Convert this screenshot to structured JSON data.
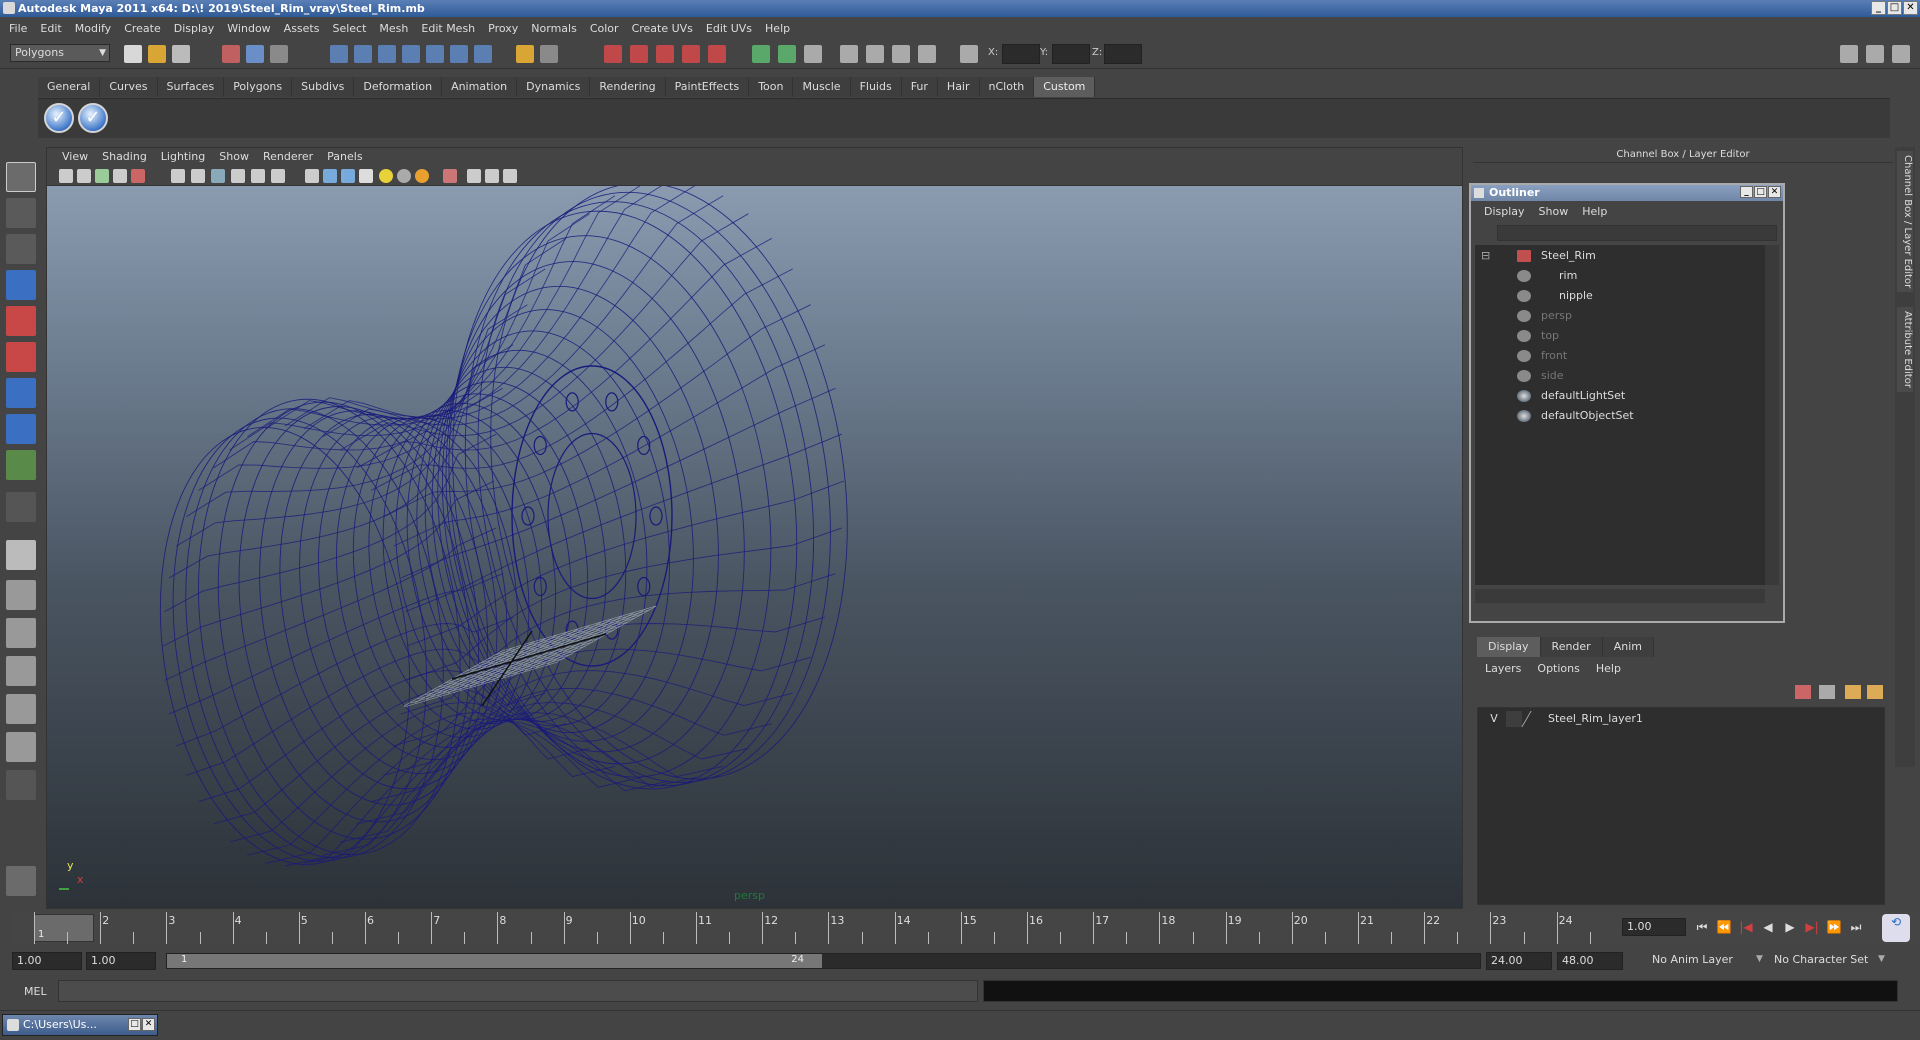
{
  "window": {
    "title": "Autodesk Maya 2011 x64: D:\\! 2019\\Steel_Rim_vray\\Steel_Rim.mb",
    "buttons": [
      "_",
      "□",
      "✕"
    ]
  },
  "menubar": [
    "File",
    "Edit",
    "Modify",
    "Create",
    "Display",
    "Window",
    "Assets",
    "Select",
    "Mesh",
    "Edit Mesh",
    "Proxy",
    "Normals",
    "Color",
    "Create UVs",
    "Edit UVs",
    "Help"
  ],
  "toolbar": {
    "mode": "Polygons",
    "coords": [
      "X:",
      "Y:",
      "Z:"
    ]
  },
  "shelf": {
    "tabs": [
      "General",
      "Curves",
      "Surfaces",
      "Polygons",
      "Subdivs",
      "Deformation",
      "Animation",
      "Dynamics",
      "Rendering",
      "PaintEffects",
      "Toon",
      "Muscle",
      "Fluids",
      "Fur",
      "Hair",
      "nCloth",
      "Custom"
    ],
    "active_tab": "Custom"
  },
  "viewport": {
    "menu": [
      "View",
      "Shading",
      "Lighting",
      "Show",
      "Renderer",
      "Panels"
    ],
    "camera": "persp",
    "axis_y": "y",
    "axis_x": "x",
    "wire_color": "#1a1a7a"
  },
  "right_panel": {
    "title": "Channel Box / Layer Editor"
  },
  "outliner": {
    "title": "Outliner",
    "menu": [
      "Display",
      "Show",
      "Help"
    ],
    "items": [
      {
        "label": "Steel_Rim",
        "dim": false
      },
      {
        "label": "rim",
        "dim": false
      },
      {
        "label": "nipple",
        "dim": false
      },
      {
        "label": "persp",
        "dim": true
      },
      {
        "label": "top",
        "dim": true
      },
      {
        "label": "front",
        "dim": true
      },
      {
        "label": "side",
        "dim": true
      },
      {
        "label": "defaultLightSet",
        "dim": false
      },
      {
        "label": "defaultObjectSet",
        "dim": false
      }
    ]
  },
  "layer_editor": {
    "tabs": [
      "Display",
      "Render",
      "Anim"
    ],
    "active_tab": "Display",
    "menu": [
      "Layers",
      "Options",
      "Help"
    ],
    "layer": {
      "visible": "V",
      "name": "Steel_Rim_layer1"
    }
  },
  "side_tabs": [
    "Channel Box / Layer Editor",
    "Attribute Editor"
  ],
  "time_slider": {
    "ticks": [
      "1",
      "2",
      "3",
      "4",
      "5",
      "6",
      "7",
      "8",
      "9",
      "10",
      "11",
      "12",
      "13",
      "14",
      "15",
      "16",
      "17",
      "18",
      "19",
      "20",
      "21",
      "22",
      "23",
      "24"
    ],
    "current_frame": "1",
    "current_time": "1.00"
  },
  "range": {
    "start_time": "1.00",
    "playback_start": "1.00",
    "range_start": "1",
    "range_end": "24",
    "playback_end": "24.00",
    "end_time": "48.00",
    "anim_layer": "No Anim Layer",
    "character_set": "No Character Set"
  },
  "command_line": {
    "label": "MEL"
  },
  "taskbar": {
    "item": "C:\\Users\\Us..."
  }
}
